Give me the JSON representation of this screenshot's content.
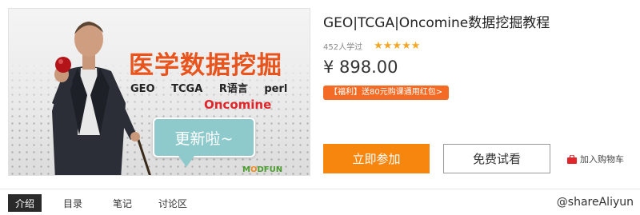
{
  "banner": {
    "headline": "医学数据挖掘",
    "tags": [
      "GEO",
      "TCGA",
      "R语言",
      "perl"
    ],
    "subtitle": "Oncomine",
    "bubble": "更新啦~",
    "logo_main": "M",
    "logo_accent": "O",
    "logo_rest": "DFUN"
  },
  "course": {
    "title": "GEO|TCGA|Oncomine数据挖掘教程",
    "learners": "452人学过",
    "rating": 5,
    "price": "¥ 898.00",
    "promo": "【福利】送80元购课通用红包>"
  },
  "actions": {
    "join": "立即参加",
    "trial": "免费试看",
    "cart": "加入购物车"
  },
  "tabs": [
    {
      "label": "介绍",
      "active": true
    },
    {
      "label": "目录",
      "active": false
    },
    {
      "label": "笔记",
      "active": false
    },
    {
      "label": "讨论区",
      "active": false
    }
  ],
  "watermark": "@shareAliyun",
  "colors": {
    "accent": "#f7860f",
    "headline": "#e8541c",
    "promo": "#f36b24",
    "star": "#f5a623"
  }
}
